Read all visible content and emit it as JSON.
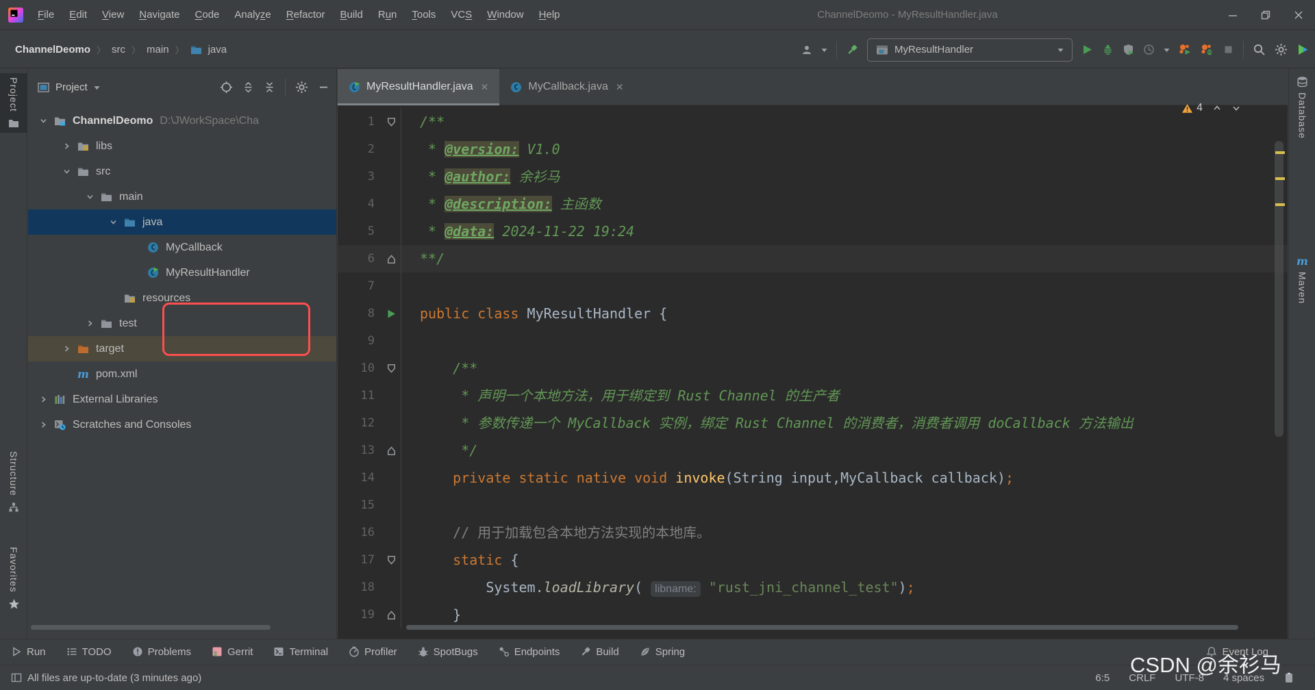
{
  "window": {
    "title": "ChannelDeomo - MyResultHandler.java"
  },
  "menubar": {
    "items": [
      {
        "label": "File",
        "m": 0
      },
      {
        "label": "Edit",
        "m": 0
      },
      {
        "label": "View",
        "m": 0
      },
      {
        "label": "Navigate",
        "m": 0
      },
      {
        "label": "Code",
        "m": 0
      },
      {
        "label": "Analyze",
        "m": 5
      },
      {
        "label": "Refactor",
        "m": 0
      },
      {
        "label": "Build",
        "m": 0
      },
      {
        "label": "Run",
        "m": 1
      },
      {
        "label": "Tools",
        "m": 0
      },
      {
        "label": "VCS",
        "m": 2
      },
      {
        "label": "Window",
        "m": 0
      },
      {
        "label": "Help",
        "m": 0
      }
    ]
  },
  "toolbar": {
    "breadcrumbs": [
      "ChannelDeomo",
      "src",
      "main",
      "java"
    ],
    "run_config": "MyResultHandler",
    "left_icons": [
      "user-icon",
      "caret-down-icon",
      "separator",
      "build-hammer-icon"
    ],
    "right_icons": [
      "run-icon",
      "debug-icon",
      "coverage-icon",
      "profiler-clock-icon",
      "caret-down-icon",
      "profile-run-icon",
      "profile-debug-icon",
      "stop-icon",
      "separator",
      "search-icon",
      "settings-gear-icon",
      "plugin-icon"
    ]
  },
  "left_stripe": [
    {
      "label": "Project",
      "icon": "stripe-folder-icon",
      "active": true
    },
    {
      "label": "Structure",
      "icon": "structure-icon",
      "active": false
    },
    {
      "label": "Favorites",
      "icon": "star-icon",
      "active": false
    }
  ],
  "right_stripe": [
    {
      "label": "Database",
      "icon": "database-icon"
    },
    {
      "label": "Maven",
      "icon": "maven-icon"
    }
  ],
  "project_panel": {
    "title": "Project",
    "header_icons": [
      "locate-icon",
      "expand-all-icon",
      "collapse-all-icon",
      "separator",
      "settings-gear-icon",
      "hide-icon"
    ],
    "tree": [
      {
        "label": "ChannelDeomo",
        "path": "D:\\JWorkSpace\\Cha",
        "depth": 0,
        "chevron": "down",
        "icon": "project-folder-icon",
        "bold": true
      },
      {
        "label": "libs",
        "depth": 1,
        "chevron": "right",
        "icon": "library-folder-icon"
      },
      {
        "label": "src",
        "depth": 1,
        "chevron": "down",
        "icon": "folder-icon"
      },
      {
        "label": "main",
        "depth": 2,
        "chevron": "down",
        "icon": "folder-icon"
      },
      {
        "label": "java",
        "depth": 3,
        "chevron": "down",
        "icon": "source-folder-icon",
        "selected": true
      },
      {
        "label": "MyCallback",
        "depth": 4,
        "chevron": "none",
        "icon": "class-icon"
      },
      {
        "label": "MyResultHandler",
        "depth": 4,
        "chevron": "none",
        "icon": "class-run-icon"
      },
      {
        "label": "resources",
        "depth": 3,
        "chevron": "none",
        "icon": "resources-folder-icon"
      },
      {
        "label": "test",
        "depth": 2,
        "chevron": "right",
        "icon": "folder-icon"
      },
      {
        "label": "target",
        "depth": 1,
        "chevron": "right",
        "icon": "excluded-folder-icon",
        "highlighted": true
      },
      {
        "label": "pom.xml",
        "depth": 1,
        "chevron": "none",
        "icon": "maven-icon"
      },
      {
        "label": "External Libraries",
        "depth": 0,
        "chevron": "right",
        "icon": "external-libraries-icon"
      },
      {
        "label": "Scratches and Consoles",
        "depth": 0,
        "chevron": "right",
        "icon": "scratches-icon"
      }
    ]
  },
  "editor": {
    "tabs": [
      {
        "label": "MyResultHandler.java",
        "icon": "class-run-icon",
        "active": true
      },
      {
        "label": "MyCallback.java",
        "icon": "class-icon",
        "active": false
      }
    ],
    "inspections": {
      "warnings": "4"
    },
    "caret_line": 6,
    "lines": [
      {
        "n": 1,
        "gutter": "fold-down",
        "segs": [
          {
            "t": "/**",
            "c": "doc"
          }
        ]
      },
      {
        "n": 2,
        "gutter": "",
        "segs": [
          {
            "t": " * ",
            "c": "doc"
          },
          {
            "t": "@version:",
            "c": "tag"
          },
          {
            "t": " V1.0",
            "c": "doc"
          }
        ]
      },
      {
        "n": 3,
        "gutter": "",
        "segs": [
          {
            "t": " * ",
            "c": "doc"
          },
          {
            "t": "@author:",
            "c": "tag"
          },
          {
            "t": " 余衫马",
            "c": "doc"
          }
        ]
      },
      {
        "n": 4,
        "gutter": "",
        "segs": [
          {
            "t": " * ",
            "c": "doc"
          },
          {
            "t": "@description:",
            "c": "tag"
          },
          {
            "t": " 主函数",
            "c": "doc"
          }
        ]
      },
      {
        "n": 5,
        "gutter": "",
        "segs": [
          {
            "t": " * ",
            "c": "doc"
          },
          {
            "t": "@data:",
            "c": "tag"
          },
          {
            "t": " 2024-11-22 19:24",
            "c": "doc"
          }
        ]
      },
      {
        "n": 6,
        "gutter": "fold-up",
        "segs": [
          {
            "t": "**/",
            "c": "doc"
          }
        ]
      },
      {
        "n": 7,
        "gutter": "",
        "segs": []
      },
      {
        "n": 8,
        "gutter": "run",
        "segs": [
          {
            "t": "public class ",
            "c": "kw"
          },
          {
            "t": "MyResultHandler {",
            "c": "plain"
          }
        ]
      },
      {
        "n": 9,
        "gutter": "",
        "segs": []
      },
      {
        "n": 10,
        "gutter": "fold-down",
        "segs": [
          {
            "t": "    /**",
            "c": "doc"
          }
        ]
      },
      {
        "n": 11,
        "gutter": "",
        "segs": [
          {
            "t": "     * 声明一个本地方法，用于绑定到 Rust Channel 的生产者",
            "c": "doc"
          }
        ]
      },
      {
        "n": 12,
        "gutter": "",
        "segs": [
          {
            "t": "     * 参数传递一个 MyCallback 实例，绑定 Rust Channel 的消费者，消费者调用 doCallback 方法输出",
            "c": "doc"
          }
        ]
      },
      {
        "n": 13,
        "gutter": "fold-up",
        "segs": [
          {
            "t": "     */",
            "c": "doc"
          }
        ]
      },
      {
        "n": 14,
        "gutter": "",
        "segs": [
          {
            "t": "    ",
            "c": "plain"
          },
          {
            "t": "private static native void ",
            "c": "kw"
          },
          {
            "t": "invoke",
            "c": "fn"
          },
          {
            "t": "(String input,MyCallback callback)",
            "c": "plain"
          },
          {
            "t": ";",
            "c": "kw"
          }
        ]
      },
      {
        "n": 15,
        "gutter": "",
        "segs": []
      },
      {
        "n": 16,
        "gutter": "",
        "segs": [
          {
            "t": "    ",
            "c": "plain"
          },
          {
            "t": "// 用于加载包含本地方法实现的本地库。",
            "c": "cmt"
          }
        ]
      },
      {
        "n": 17,
        "gutter": "fold-down",
        "segs": [
          {
            "t": "    ",
            "c": "plain"
          },
          {
            "t": "static",
            "c": "kw"
          },
          {
            "t": " {",
            "c": "plain"
          }
        ]
      },
      {
        "n": 18,
        "gutter": "",
        "segs": [
          {
            "t": "        ",
            "c": "plain"
          },
          {
            "t": "System.",
            "c": "plain"
          },
          {
            "t": "loadLibrary",
            "c": "fni"
          },
          {
            "t": "( ",
            "c": "plain"
          },
          {
            "t": "libname:",
            "c": "inlay"
          },
          {
            "t": " ",
            "c": "plain"
          },
          {
            "t": "\"rust_jni_channel_test\"",
            "c": "str"
          },
          {
            "t": ")",
            "c": "plain"
          },
          {
            "t": ";",
            "c": "kw"
          }
        ]
      },
      {
        "n": 19,
        "gutter": "fold-up",
        "segs": [
          {
            "t": "    }",
            "c": "plain"
          }
        ]
      }
    ]
  },
  "bottom_bar": {
    "left": [
      {
        "label": "Run",
        "icon": "run-tool-icon"
      },
      {
        "label": "TODO",
        "icon": "todo-icon"
      },
      {
        "label": "Problems",
        "icon": "problems-icon"
      },
      {
        "label": "Gerrit",
        "icon": "gerrit-icon"
      },
      {
        "label": "Terminal",
        "icon": "terminal-icon"
      },
      {
        "label": "Profiler",
        "icon": "profiler-icon"
      },
      {
        "label": "SpotBugs",
        "icon": "spotbugs-icon"
      },
      {
        "label": "Endpoints",
        "icon": "endpoints-icon"
      },
      {
        "label": "Build",
        "icon": "build-icon"
      },
      {
        "label": "Spring",
        "icon": "spring-icon"
      }
    ],
    "right": [
      {
        "label": "Event Log",
        "icon": "bell-icon"
      }
    ]
  },
  "status_bar": {
    "left": "All files are up-to-date (3 minutes ago)",
    "right": [
      "6:5",
      "CRLF",
      "UTF-8",
      "4 spaces"
    ]
  },
  "watermark": "CSDN @余衫马",
  "colors": {
    "panel_bg": "#3c3f41",
    "editor_bg": "#2b2b2b",
    "selection": "#11385c",
    "excluded_row": "#4d493d",
    "keyword": "#cc7832",
    "string": "#6a8759",
    "javadoc": "#629755",
    "line_comment": "#808080",
    "method": "#ffc66d",
    "warning": "#f2a53c",
    "run_green": "#499c54",
    "annotation_red": "#fd4f4f",
    "source_folder_blue": "#3f82ae",
    "excluded_folder_orange": "#bc6a2e",
    "maven_blue": "#4a9edb"
  }
}
